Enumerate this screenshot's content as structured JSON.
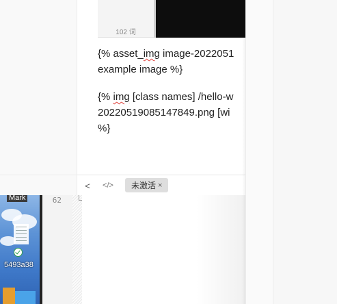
{
  "preview": {
    "thumbnail_caption": "102 词",
    "paragraph1_prefix": "{% asset_",
    "paragraph1_misspelled": "img",
    "paragraph1_suffix": " image-2022051",
    "paragraph1_line2": "example image %}",
    "paragraph2_prefix": "{% ",
    "paragraph2_misspelled": "img",
    "paragraph2_suffix": " [class names] /hello-w",
    "paragraph2_line2": "20220519085147849.png [wi",
    "paragraph2_line3": "%}"
  },
  "toolbar": {
    "back_icon": "<",
    "code_icon": "</>",
    "tag_label": "未激活",
    "tag_close": "×"
  },
  "file_browser": {
    "label": "Mark",
    "file_name": "5493a38"
  },
  "editor": {
    "line_number": "62"
  },
  "colors": {
    "spellcheck_underline": "#e0403a",
    "tag_chip_bg": "#dedede",
    "sync_check": "#2e9f4c"
  }
}
